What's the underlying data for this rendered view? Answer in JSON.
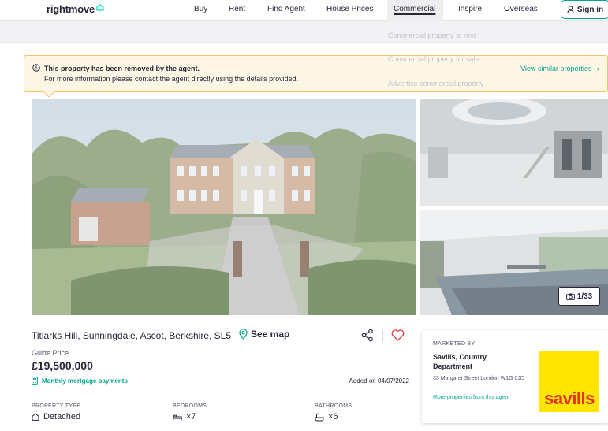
{
  "header": {
    "logo_text": "rightmove",
    "nav": [
      {
        "label": "Buy"
      },
      {
        "label": "Rent"
      },
      {
        "label": "Find Agent"
      },
      {
        "label": "House Prices"
      },
      {
        "label": "Commercial"
      },
      {
        "label": "Inspire"
      },
      {
        "label": "Overseas"
      }
    ],
    "active_nav": "Commercial",
    "signin_label": "Sign in"
  },
  "dropdown": {
    "items": [
      {
        "label": "Commercial property to rent"
      },
      {
        "label": "Commercial property for sale"
      },
      {
        "label": "Advertise commercial property"
      }
    ]
  },
  "notice": {
    "title": "This property has been removed by the agent.",
    "text": "For more information please contact the agent directly using the details provided.",
    "link": "View similar properties"
  },
  "gallery": {
    "photo_count": "1/33"
  },
  "property": {
    "address": "Titlarks Hill, Sunningdale, Ascot, Berkshire, SL5",
    "see_map": "See map",
    "price_qualifier": "Guide Price",
    "price": "£19,500,000",
    "mortgage_link": "Monthly mortgage payments",
    "added": "Added on 04/07/2022",
    "key_features": [
      {
        "label": "PROPERTY TYPE",
        "value": "Detached",
        "icon": "house-icon"
      },
      {
        "label": "BEDROOMS",
        "value": "×7",
        "icon": "bed-icon"
      },
      {
        "label": "BATHROOMS",
        "value": "×6",
        "icon": "bath-icon"
      }
    ]
  },
  "agent": {
    "marketed_by": "MARKETED BY",
    "name": "Savills, Country Department",
    "address": "33 Margaret Street London W1G 0JD",
    "more_link": "More properties from this agent",
    "logo_text": "savills"
  },
  "colors": {
    "accent": "#00a48f",
    "notice_bg": "#fdf6e5",
    "notice_border": "#f3c46b",
    "heart": "#e2424b",
    "savills_yellow": "#ffe500",
    "savills_red": "#e63027"
  }
}
